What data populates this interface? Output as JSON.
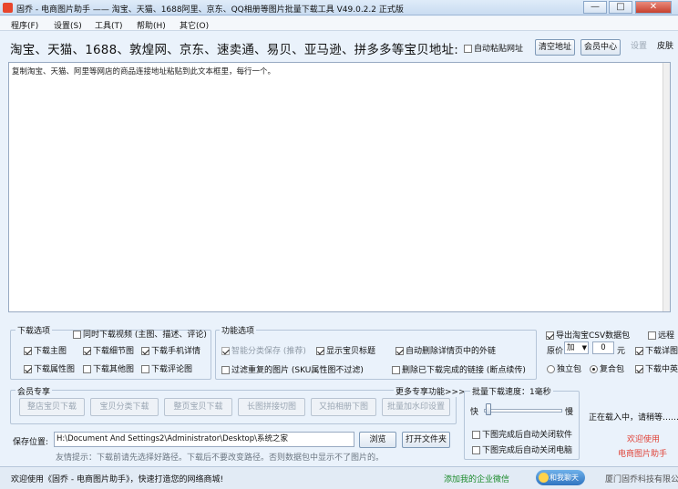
{
  "window": {
    "title": "固乔 - 电商图片助手 —— 淘宝、天猫、1688阿里、京东、QQ相册等图片批量下载工具 V49.0.2.2 正式版",
    "minimize": "—",
    "maximize": "□",
    "close": "✕"
  },
  "menu": [
    "程序(F)",
    "设置(S)",
    "工具(T)",
    "帮助(H)",
    "其它(O)"
  ],
  "urlbar": {
    "label": "淘宝、天猫、1688、敦煌网、京东、速卖通、易贝、亚马逊、拼多多等宝贝地址:",
    "auto_paste": "自动粘贴网址",
    "clear": "清空地址",
    "member": "会员中心",
    "settings": "设置",
    "skin": "皮肤"
  },
  "textarea": {
    "hint": "复制淘宝、天猫、阿里等网店的商品连接地址粘贴到此文本框里，每行一个。"
  },
  "download_options": {
    "title": "下载选项",
    "video": "同时下载视频 (主图、描述、评论)",
    "items": [
      {
        "label": "下载主图",
        "checked": true
      },
      {
        "label": "下载细节图",
        "checked": true
      },
      {
        "label": "下载手机详情",
        "checked": true
      },
      {
        "label": "下载属性图",
        "checked": true
      },
      {
        "label": "下载其他图",
        "checked": false
      },
      {
        "label": "下载评论图",
        "checked": false
      }
    ]
  },
  "function_options": {
    "title": "功能选项",
    "smart": "智能分类保存 (推荐)",
    "show_title": "显示宝贝标题",
    "auto_delete": "自动删除详情页中的外链",
    "filter": "过滤重复的图片 (SKU属性图不过滤)",
    "delete_done": "删除已下载完成的链接 (断点续传)"
  },
  "csv": {
    "export": "导出淘宝CSV数据包",
    "remote": "远程",
    "price_label": "原价",
    "price_op": "加",
    "price_value": "0",
    "unit": "元",
    "detail": "下载详图",
    "independent": "独立包",
    "composite": "复合包",
    "download_cn": "下载中英日"
  },
  "member": {
    "title": "会员专享",
    "more": "更多专享功能>>>",
    "buttons": [
      "整店宝贝下载",
      "宝贝分类下载",
      "整页宝贝下载",
      "长图拼接切图",
      "又拍相册下图",
      "批量加水印设置"
    ]
  },
  "batch": {
    "title": "批量下载速度：1毫秒",
    "fast": "快",
    "slow": "慢",
    "close_sw": "下图完成后自动关闭软件",
    "shutdown": "下图完成后自动关闭电脑"
  },
  "loading": "正在载入中，请稍等……",
  "welcome": {
    "line1": "欢迎使用",
    "line2": "电商图片助手"
  },
  "save": {
    "label": "保存位置:",
    "path": "H:\\Document And Settings2\\Administrator\\Desktop\\系统之家",
    "browse": "浏览",
    "open": "打开文件夹",
    "tip": "友情提示：下载前请先选择好路径。下载后不要改变路径。否则数据包中显示不了图片的。"
  },
  "status": {
    "welcome": "欢迎使用《固乔 - 电商图片助手》，快速打造您的网络商城!",
    "wechat": "添加我的企业微信",
    "badge": "和我聊天",
    "company": "厦门固乔科技有限公司"
  },
  "colors": {
    "accent_red": "#e0443a",
    "link_green": "#1a8a2a",
    "title_bg": "#cfe0f3"
  }
}
